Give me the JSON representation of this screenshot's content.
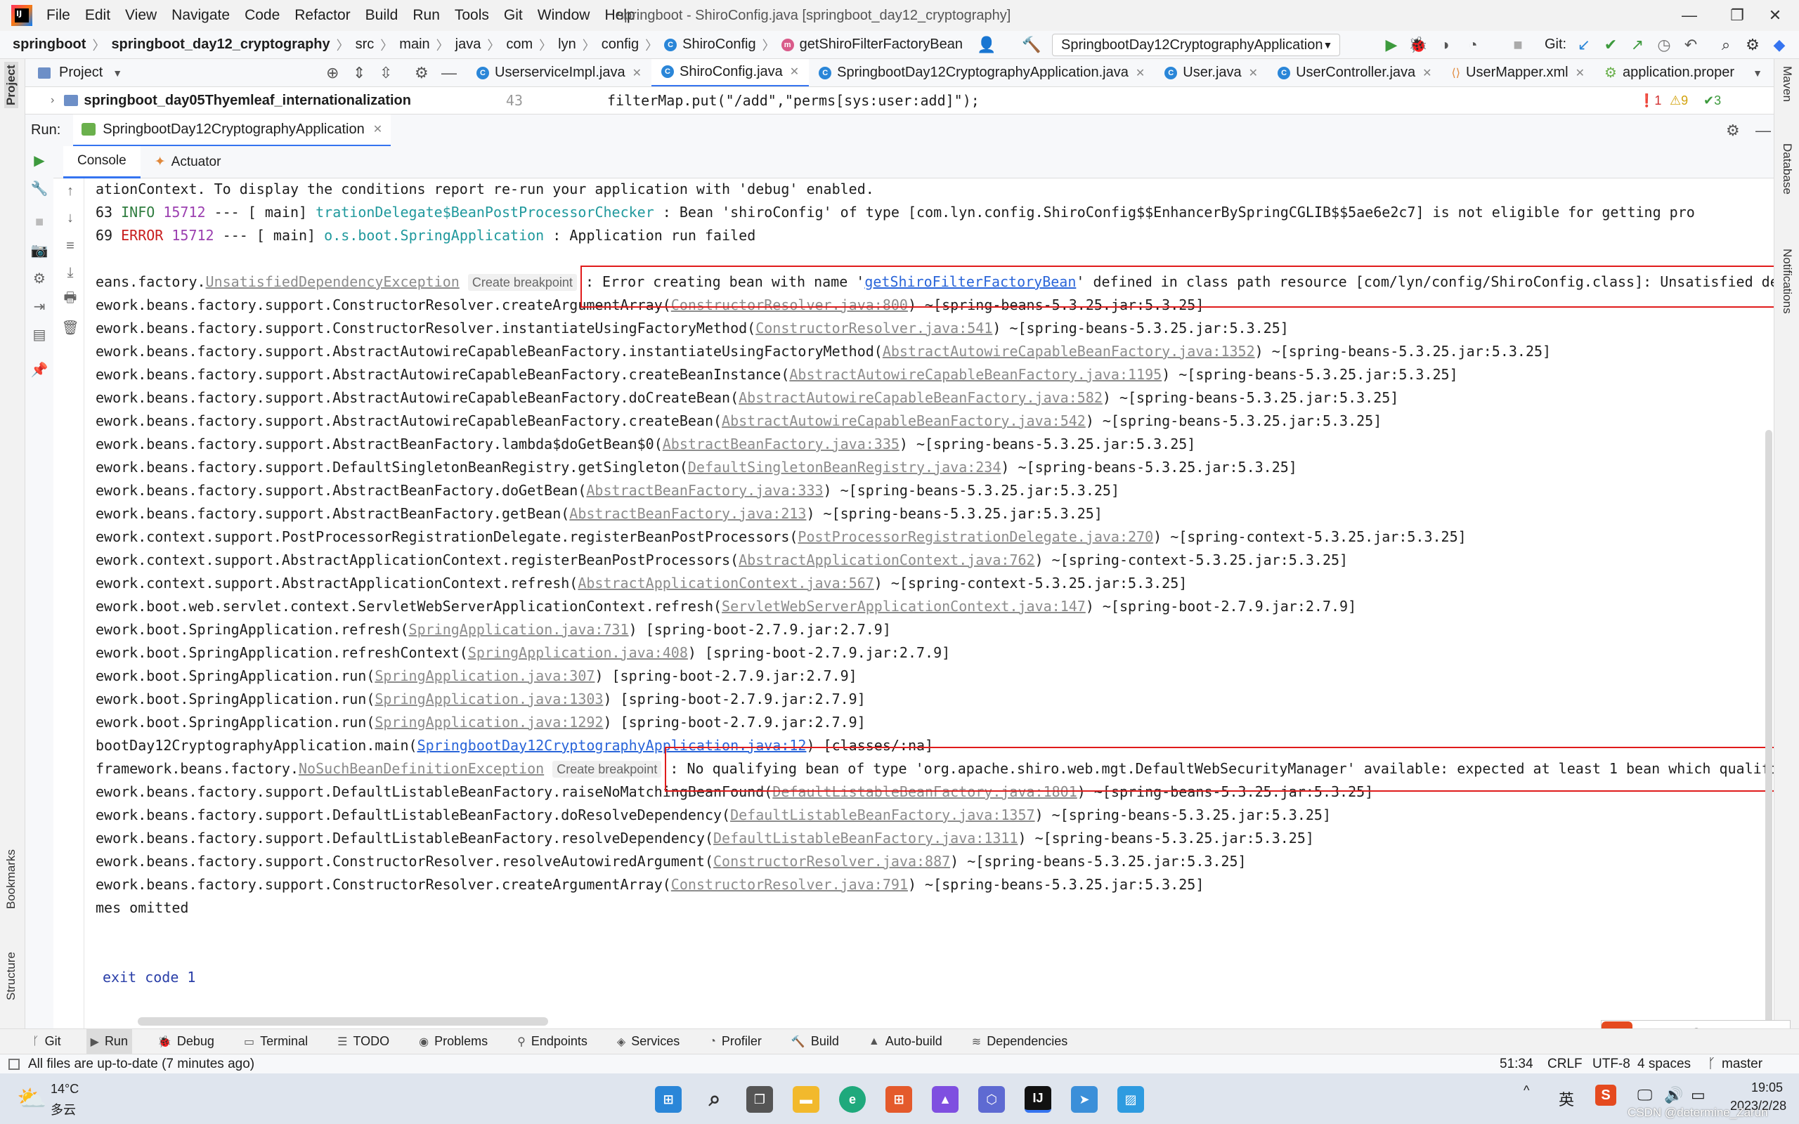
{
  "menu": {
    "items": [
      "File",
      "Edit",
      "View",
      "Navigate",
      "Code",
      "Refactor",
      "Build",
      "Run",
      "Tools",
      "Git",
      "Window",
      "Help"
    ],
    "window_title": "springboot - ShiroConfig.java [springboot_day12_cryptography]",
    "minimize": "—",
    "restore": "❐",
    "close": "✕"
  },
  "breadcrumbs": [
    "springboot",
    "springboot_day12_cryptography",
    "src",
    "main",
    "java",
    "com",
    "lyn",
    "config",
    "ShiroConfig",
    "getShiroFilterFactoryBean"
  ],
  "navbar": {
    "run_config": "SpringbootDay12CryptographyApplication",
    "git_label": "Git:"
  },
  "project": {
    "title": "Project",
    "tree_item": "springboot_day05Thyemleaf_internationalization"
  },
  "editor_tabs": [
    {
      "label": "UserserviceImpl.java",
      "active": false
    },
    {
      "label": "ShiroConfig.java",
      "active": true
    },
    {
      "label": "SpringbootDay12CryptographyApplication.java",
      "active": false
    },
    {
      "label": "User.java",
      "active": false
    },
    {
      "label": "UserController.java",
      "active": false
    },
    {
      "label": "UserMapper.xml",
      "active": false
    },
    {
      "label": "application.proper",
      "active": false
    }
  ],
  "editor_peek": {
    "line_number": "43",
    "code": "filterMap.put(\"/add\",\"perms[sys:user:add]\");",
    "errors": "1",
    "warnings": "9",
    "ok": "3"
  },
  "run": {
    "label": "Run:",
    "config": "SpringbootDay12CryptographyApplication",
    "tabs": [
      "Console",
      "Actuator"
    ]
  },
  "console": {
    "line1": "ationContext. To display the conditions report re-run your application with 'debug' enabled.",
    "line2": {
      "prefix": "63  ",
      "level": "INFO",
      "pid": "15712",
      "sep": " --- [           main] ",
      "logger": "trationDelegate$BeanPostProcessorChecker",
      "msg": " : Bean 'shiroConfig' of type [com.lyn.config.ShiroConfig$$EnhancerBySpringCGLIB$$5ae6e2c7] is not eligible for getting pro"
    },
    "line3": {
      "prefix": "69 ",
      "level": "ERROR",
      "pid": "15712",
      "sep": " --- [           main] ",
      "logger": "o.s.boot.SpringApplication",
      "msg": "               : Application run failed"
    },
    "exc1": {
      "pre": "eans.factory.",
      "link": "UnsatisfiedDependencyException",
      "bp": "Create breakpoint",
      "msg_pre": ": Error creating bean with name '",
      "msg_link": "getShiroFilterFactoryBean",
      "msg_post": "' defined in class path resource [com/lyn/config/ShiroConfig.class]: Unsatisfied dep"
    },
    "stack1": [
      {
        "pre": "ework.beans.factory.support.ConstructorResolver.createArgumentArray(",
        "link": "ConstructorResolver.java:800",
        "post": ") ~[spring-beans-5.3.25.jar:5.3.25]"
      },
      {
        "pre": "ework.beans.factory.support.ConstructorResolver.instantiateUsingFactoryMethod(",
        "link": "ConstructorResolver.java:541",
        "post": ") ~[spring-beans-5.3.25.jar:5.3.25]"
      },
      {
        "pre": "ework.beans.factory.support.AbstractAutowireCapableBeanFactory.instantiateUsingFactoryMethod(",
        "link": "AbstractAutowireCapableBeanFactory.java:1352",
        "post": ") ~[spring-beans-5.3.25.jar:5.3.25]"
      },
      {
        "pre": "ework.beans.factory.support.AbstractAutowireCapableBeanFactory.createBeanInstance(",
        "link": "AbstractAutowireCapableBeanFactory.java:1195",
        "post": ") ~[spring-beans-5.3.25.jar:5.3.25]"
      },
      {
        "pre": "ework.beans.factory.support.AbstractAutowireCapableBeanFactory.doCreateBean(",
        "link": "AbstractAutowireCapableBeanFactory.java:582",
        "post": ") ~[spring-beans-5.3.25.jar:5.3.25]"
      },
      {
        "pre": "ework.beans.factory.support.AbstractAutowireCapableBeanFactory.createBean(",
        "link": "AbstractAutowireCapableBeanFactory.java:542",
        "post": ") ~[spring-beans-5.3.25.jar:5.3.25]"
      },
      {
        "pre": "ework.beans.factory.support.AbstractBeanFactory.lambda$doGetBean$0(",
        "link": "AbstractBeanFactory.java:335",
        "post": ") ~[spring-beans-5.3.25.jar:5.3.25]"
      },
      {
        "pre": "ework.beans.factory.support.DefaultSingletonBeanRegistry.getSingleton(",
        "link": "DefaultSingletonBeanRegistry.java:234",
        "post": ") ~[spring-beans-5.3.25.jar:5.3.25]"
      },
      {
        "pre": "ework.beans.factory.support.AbstractBeanFactory.doGetBean(",
        "link": "AbstractBeanFactory.java:333",
        "post": ") ~[spring-beans-5.3.25.jar:5.3.25]"
      },
      {
        "pre": "ework.beans.factory.support.AbstractBeanFactory.getBean(",
        "link": "AbstractBeanFactory.java:213",
        "post": ") ~[spring-beans-5.3.25.jar:5.3.25]"
      },
      {
        "pre": "ework.context.support.PostProcessorRegistrationDelegate.registerBeanPostProcessors(",
        "link": "PostProcessorRegistrationDelegate.java:270",
        "post": ") ~[spring-context-5.3.25.jar:5.3.25]"
      },
      {
        "pre": "ework.context.support.AbstractApplicationContext.registerBeanPostProcessors(",
        "link": "AbstractApplicationContext.java:762",
        "post": ") ~[spring-context-5.3.25.jar:5.3.25]"
      },
      {
        "pre": "ework.context.support.AbstractApplicationContext.refresh(",
        "link": "AbstractApplicationContext.java:567",
        "post": ") ~[spring-context-5.3.25.jar:5.3.25]"
      },
      {
        "pre": "ework.boot.web.servlet.context.ServletWebServerApplicationContext.refresh(",
        "link": "ServletWebServerApplicationContext.java:147",
        "post": ") ~[spring-boot-2.7.9.jar:2.7.9]"
      },
      {
        "pre": "ework.boot.SpringApplication.refresh(",
        "link": "SpringApplication.java:731",
        "post": ") [spring-boot-2.7.9.jar:2.7.9]"
      },
      {
        "pre": "ework.boot.SpringApplication.refreshContext(",
        "link": "SpringApplication.java:408",
        "post": ") [spring-boot-2.7.9.jar:2.7.9]"
      },
      {
        "pre": "ework.boot.SpringApplication.run(",
        "link": "SpringApplication.java:307",
        "post": ") [spring-boot-2.7.9.jar:2.7.9]"
      },
      {
        "pre": "ework.boot.SpringApplication.run(",
        "link": "SpringApplication.java:1303",
        "post": ") [spring-boot-2.7.9.jar:2.7.9]"
      },
      {
        "pre": "ework.boot.SpringApplication.run(",
        "link": "SpringApplication.java:1292",
        "post": ") [spring-boot-2.7.9.jar:2.7.9]"
      }
    ],
    "main_line": {
      "pre": "bootDay12CryptographyApplication.main(",
      "link": "SpringbootDay12CryptographyApplication.java:12",
      "post": ") [classes/:na]"
    },
    "exc2": {
      "pre": "framework.beans.factory.",
      "link": "NoSuchBeanDefinitionException",
      "bp": "Create breakpoint",
      "msg": ": No qualifying bean of type 'org.apache.shiro.web.mgt.DefaultWebSecurityManager' available: expected at least 1 bean which qualifie"
    },
    "stack2": [
      {
        "pre": "ework.beans.factory.support.DefaultListableBeanFactory.raiseNoMatchingBeanFound(",
        "link": "DefaultListableBeanFactory.java:1801",
        "post": ") ~[spring-beans-5.3.25.jar:5.3.25]"
      },
      {
        "pre": "ework.beans.factory.support.DefaultListableBeanFactory.doResolveDependency(",
        "link": "DefaultListableBeanFactory.java:1357",
        "post": ") ~[spring-beans-5.3.25.jar:5.3.25]"
      },
      {
        "pre": "ework.beans.factory.support.DefaultListableBeanFactory.resolveDependency(",
        "link": "DefaultListableBeanFactory.java:1311",
        "post": ") ~[spring-beans-5.3.25.jar:5.3.25]"
      },
      {
        "pre": "ework.beans.factory.support.ConstructorResolver.resolveAutowiredArgument(",
        "link": "ConstructorResolver.java:887",
        "post": ") ~[spring-beans-5.3.25.jar:5.3.25]"
      },
      {
        "pre": "ework.beans.factory.support.ConstructorResolver.createArgumentArray(",
        "link": "ConstructorResolver.java:791",
        "post": ") ~[spring-beans-5.3.25.jar:5.3.25]"
      }
    ],
    "omitted": "mes omitted",
    "exit": " exit code 1"
  },
  "left_stripe": {
    "project": "Project",
    "bookmarks": "Bookmarks",
    "structure": "Structure"
  },
  "right_stripe": {
    "maven": "Maven",
    "database": "Database",
    "notifications": "Notifications"
  },
  "bottom_tools": [
    "Git",
    "Run",
    "Debug",
    "Terminal",
    "TODO",
    "Problems",
    "Endpoints",
    "Services",
    "Profiler",
    "Build",
    "Auto-build",
    "Dependencies"
  ],
  "status": {
    "message": "All files are up-to-date (7 minutes ago)",
    "position": "51:34",
    "line_sep": "CRLF",
    "encoding": "UTF-8",
    "indent": "4 spaces",
    "branch": "master"
  },
  "ime": {
    "lang": "英"
  },
  "taskbar": {
    "temp": "14°C",
    "weather": "多云",
    "time": "19:05",
    "date": "2023/2/28",
    "ime": "英",
    "watermark": "CSDN @determine_Zarun"
  }
}
